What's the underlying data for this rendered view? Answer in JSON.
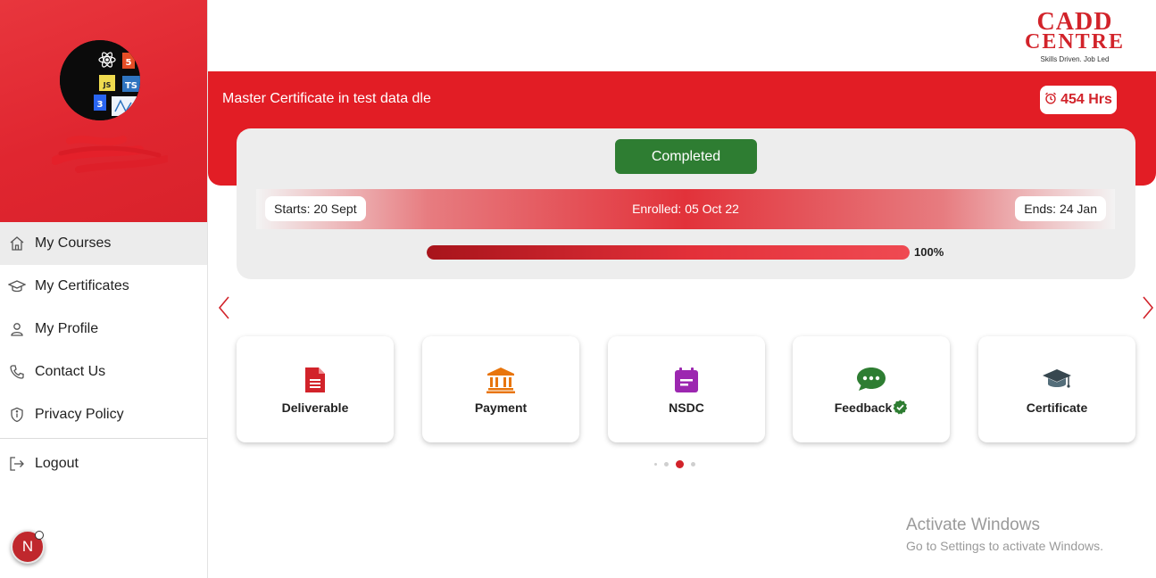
{
  "brand": {
    "logo_line1": "CADD",
    "logo_line2": "CENTRE",
    "tagline": "Skills Driven. Job Led",
    "accent": "#e21d25",
    "success": "#2e7d32"
  },
  "sidebar": {
    "items": [
      {
        "label": "My Courses",
        "icon": "home-icon",
        "active": true
      },
      {
        "label": "My Certificates",
        "icon": "graduation-cap-icon"
      },
      {
        "label": "My Profile",
        "icon": "user-icon"
      },
      {
        "label": "Contact Us",
        "icon": "phone-icon"
      },
      {
        "label": "Privacy Policy",
        "icon": "shield-icon"
      }
    ],
    "logout_label": "Logout",
    "badge_letter": "N"
  },
  "course": {
    "title": "Master Certificate in test data dle",
    "hours": "454 Hrs",
    "status": "Completed",
    "starts": "Starts: 20 Sept",
    "enrolled": "Enrolled: 05 Oct 22",
    "ends": "Ends: 24 Jan",
    "progress_label": "100%",
    "progress_fraction": 1.0
  },
  "actions": [
    {
      "label": "Deliverable",
      "icon": "document-icon"
    },
    {
      "label": "Payment",
      "icon": "bank-icon"
    },
    {
      "label": "NSDC",
      "icon": "calendar-icon"
    },
    {
      "label": "Feedback",
      "icon": "chat-icon"
    },
    {
      "label": "Certificate",
      "icon": "mortarboard-icon"
    }
  ],
  "carousel": {
    "active_index": 2,
    "count": 4
  },
  "windows_watermark": {
    "line1": "Activate Windows",
    "line2": "Go to Settings to activate Windows."
  }
}
